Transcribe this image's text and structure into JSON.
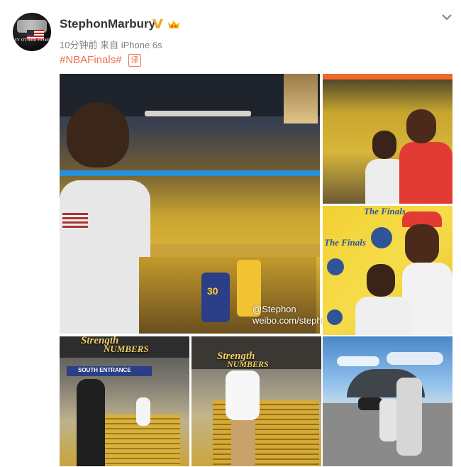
{
  "post": {
    "username": "StephonMarbury",
    "time": "10分钟前",
    "source_prefix": "来自",
    "source_device": "iPhone 6s",
    "hashtag": "#NBAFinals#",
    "translate_label": "译"
  },
  "avatar": {
    "caption": "MY OTHER HOME"
  },
  "icons": {
    "verified": "verified-v-icon",
    "vip": "vip-crown-icon",
    "menu": "chevron-down-icon"
  },
  "photos": {
    "watermark_line1": "@Stephon",
    "watermark_line2": "weibo.com/stephon",
    "jersey_number": "30",
    "banner_strength": "Strength",
    "banner_numbers": "NUMBERS",
    "south_entrance": "SOUTH ENTRANCE",
    "finals_logo": "The Finals"
  },
  "colors": {
    "username": "#333333",
    "meta": "#808080",
    "hashtag": "#eb7350",
    "verified": "#f5a623",
    "background": "#ffffff"
  }
}
